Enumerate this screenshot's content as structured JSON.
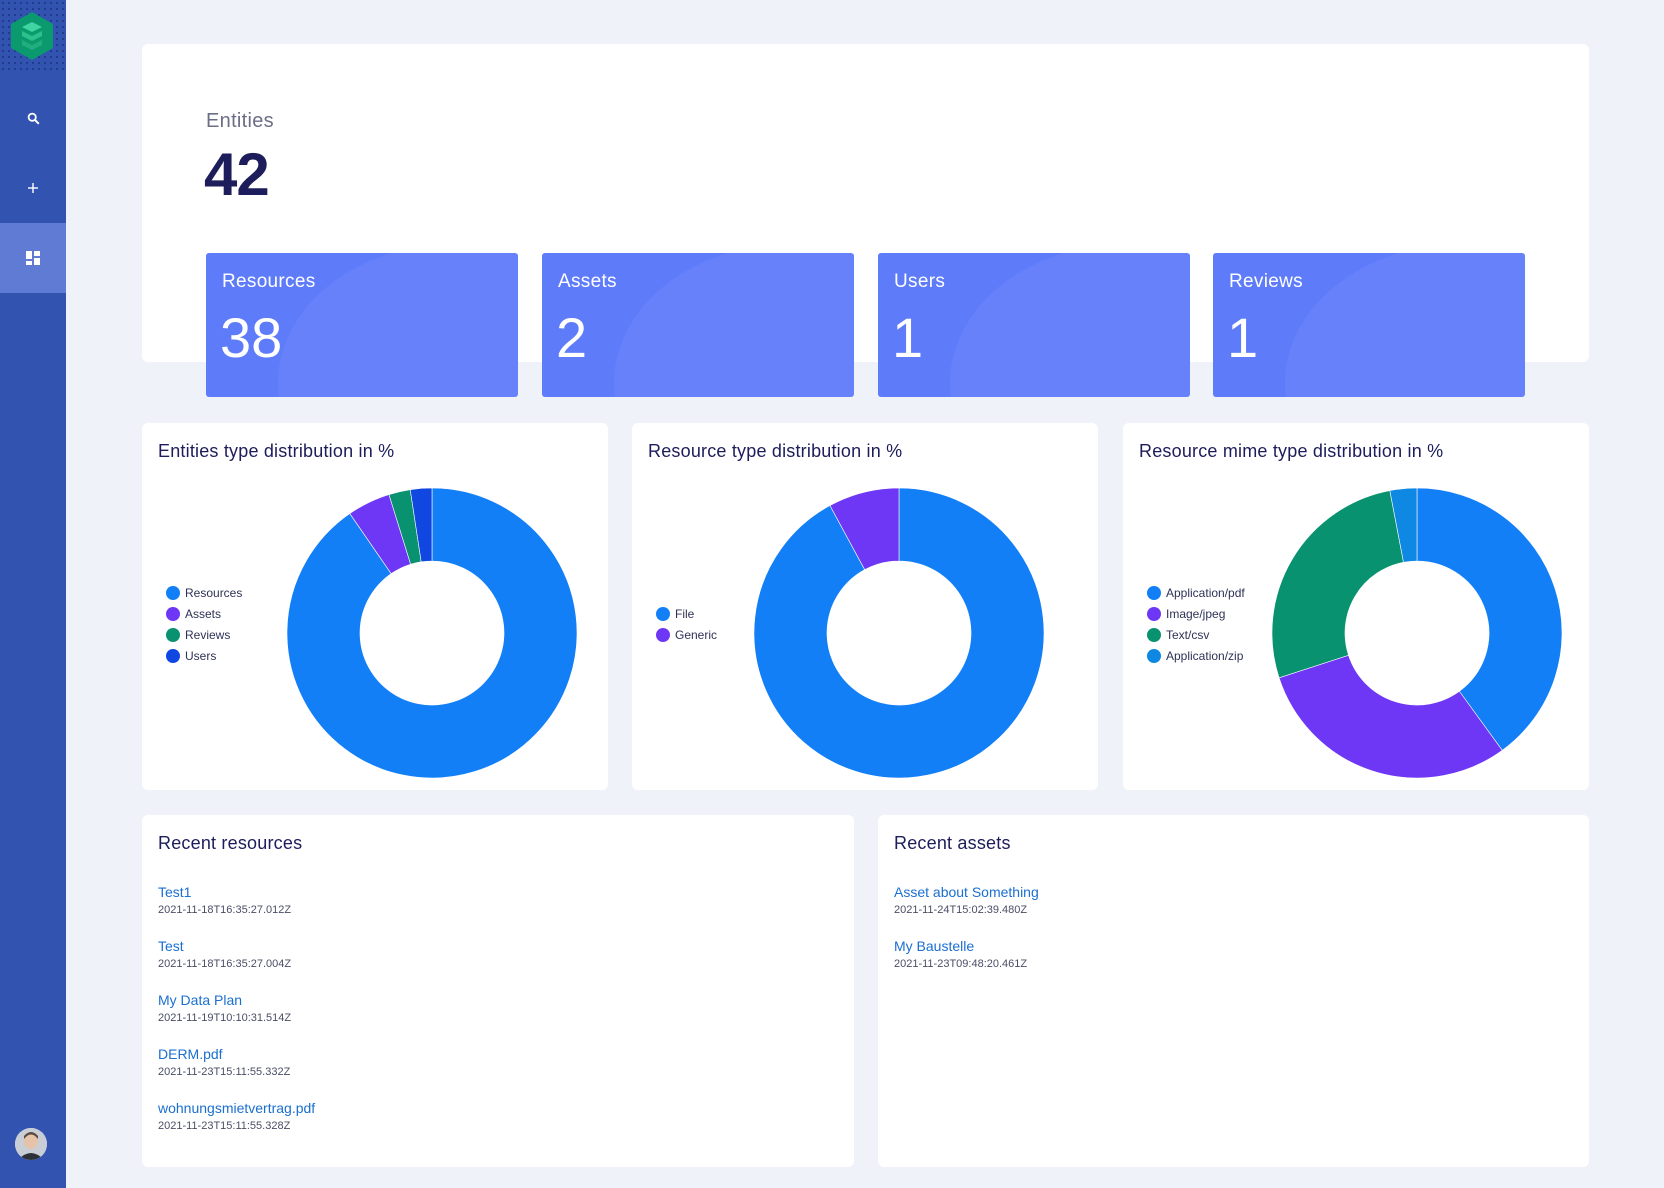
{
  "sidebar": {
    "items": [
      {
        "name": "search",
        "icon": "search-icon",
        "active": false
      },
      {
        "name": "add",
        "icon": "plus-icon",
        "active": false
      },
      {
        "name": "dashboard",
        "icon": "dashboard-icon",
        "active": true
      }
    ],
    "logo_color": "#0a9a6e",
    "bg_color": "#3353b0"
  },
  "summary": {
    "entities_label": "Entities",
    "entities_value": "42",
    "stats": [
      {
        "label": "Resources",
        "value": "38"
      },
      {
        "label": "Assets",
        "value": "2"
      },
      {
        "label": "Users",
        "value": "1"
      },
      {
        "label": "Reviews",
        "value": "1"
      }
    ]
  },
  "charts": {
    "entities": {
      "title": "Entities type distribution in %"
    },
    "resource_type": {
      "title": "Resource type distribution in %"
    },
    "mime_type": {
      "title": "Resource mime type distribution in %"
    }
  },
  "chart_data": [
    {
      "type": "pie",
      "title": "Entities type distribution in %",
      "categories": [
        "Resources",
        "Assets",
        "Reviews",
        "Users"
      ],
      "values": [
        90.5,
        4.8,
        2.4,
        2.4
      ],
      "colors": [
        "#127ff7",
        "#6d37f5",
        "#08926f",
        "#0f47e0"
      ],
      "legend_placement": "left"
    },
    {
      "type": "pie",
      "title": "Resource type distribution in %",
      "categories": [
        "File",
        "Generic"
      ],
      "values": [
        92.1,
        7.9
      ],
      "colors": [
        "#127ff7",
        "#6d37f5"
      ],
      "legend_placement": "left"
    },
    {
      "type": "pie",
      "title": "Resource mime type distribution in %",
      "categories": [
        "Application/pdf",
        "Image/jpeg",
        "Text/csv",
        "Application/zip"
      ],
      "values": [
        40,
        30,
        27,
        3
      ],
      "colors": [
        "#127ff7",
        "#6d37f5",
        "#08926f",
        "#0e88e3"
      ],
      "legend_placement": "left"
    }
  ],
  "recent_resources": {
    "title": "Recent resources",
    "items": [
      {
        "name": "Test1",
        "date": "2021-11-18T16:35:27.012Z"
      },
      {
        "name": "Test",
        "date": "2021-11-18T16:35:27.004Z"
      },
      {
        "name": "My Data Plan",
        "date": "2021-11-19T10:10:31.514Z"
      },
      {
        "name": "DERM.pdf",
        "date": "2021-11-23T15:11:55.332Z"
      },
      {
        "name": "wohnungsmietvertrag.pdf",
        "date": "2021-11-23T15:11:55.328Z"
      }
    ]
  },
  "recent_assets": {
    "title": "Recent assets",
    "items": [
      {
        "name": "Asset about Something",
        "date": "2021-11-24T15:02:39.480Z"
      },
      {
        "name": "My Baustelle",
        "date": "2021-11-23T09:48:20.461Z"
      }
    ]
  }
}
